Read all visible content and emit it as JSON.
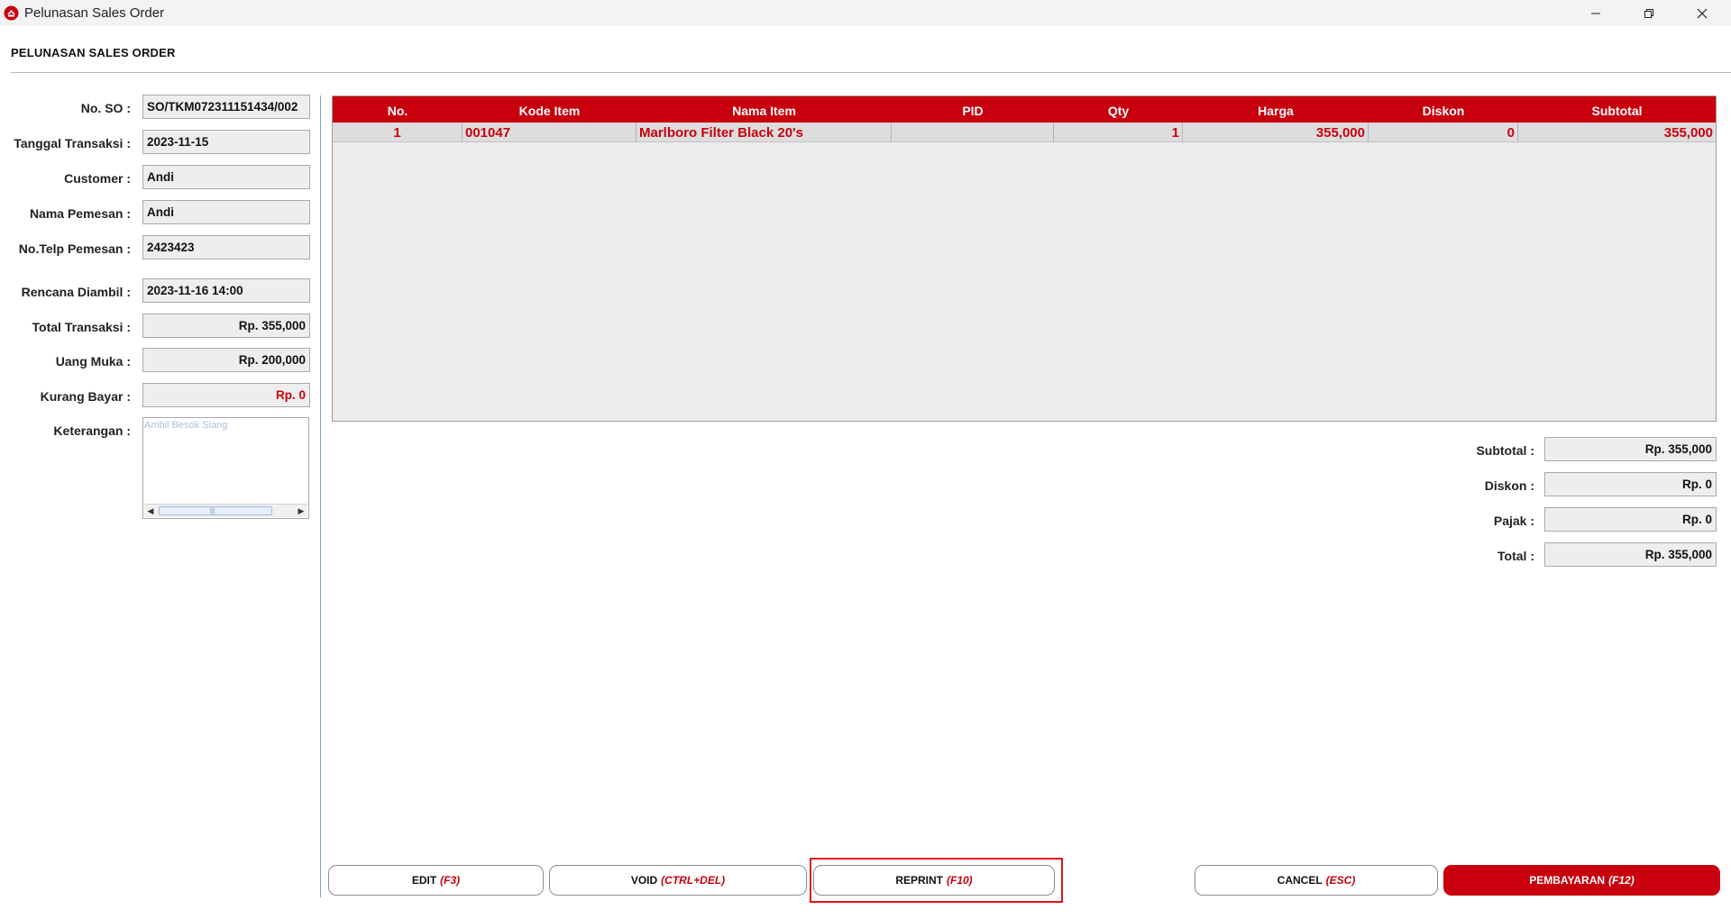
{
  "window": {
    "title": "Pelunasan Sales Order"
  },
  "form": {
    "heading": "PELUNASAN SALES ORDER"
  },
  "fields": [
    {
      "label": "No. SO :",
      "value": "SO/TKM072311151434/002",
      "align": "left",
      "red": false
    },
    {
      "label": "Tanggal Transaksi :",
      "value": "2023-11-15",
      "align": "left",
      "red": false
    },
    {
      "label": "Customer :",
      "value": "Andi",
      "align": "left",
      "red": false
    },
    {
      "label": "Nama Pemesan :",
      "value": "Andi",
      "align": "left",
      "red": false
    },
    {
      "label": "No.Telp Pemesan :",
      "value": "2423423",
      "align": "left",
      "red": false
    },
    {
      "label": "Rencana Diambil :",
      "value": "2023-11-16 14:00",
      "align": "left",
      "red": false
    },
    {
      "label": "Total Transaksi :",
      "value": "Rp. 355,000",
      "align": "right",
      "red": false
    },
    {
      "label": "Uang Muka :",
      "value": "Rp. 200,000",
      "align": "right",
      "red": false
    },
    {
      "label": "Kurang Bayar :",
      "value": "Rp. 0",
      "align": "right",
      "red": true
    }
  ],
  "keterangan": {
    "label": "Keterangan :",
    "placeholder": "Ambil Besok Siang"
  },
  "table": {
    "columns": [
      "No.",
      "Kode Item",
      "Nama Item",
      "PID",
      "Qty",
      "Harga",
      "Diskon",
      "Subtotal"
    ],
    "rows": [
      [
        "1",
        "001047",
        "Marlboro Filter Black 20's",
        "",
        "1",
        "355,000",
        "0",
        "355,000"
      ]
    ]
  },
  "summary": [
    {
      "label": "Subtotal :",
      "value": "Rp. 355,000"
    },
    {
      "label": "Diskon :",
      "value": "Rp. 0"
    },
    {
      "label": "Pajak :",
      "value": "Rp. 0"
    },
    {
      "label": "Total :",
      "value": "Rp. 355,000"
    }
  ],
  "buttons": {
    "edit": {
      "label": "EDIT",
      "key": "(F3)"
    },
    "void": {
      "label": "VOID",
      "key": "(CTRL+DEL)"
    },
    "reprint": {
      "label": "REPRINT",
      "key": "(F10)"
    },
    "cancel": {
      "label": "CANCEL",
      "key": "(ESC)"
    },
    "pembayaran": {
      "label": "PEMBAYARAN",
      "key": "(F12)"
    }
  },
  "colors": {
    "accent": "#c8000e",
    "highlight": "#e0141c"
  }
}
